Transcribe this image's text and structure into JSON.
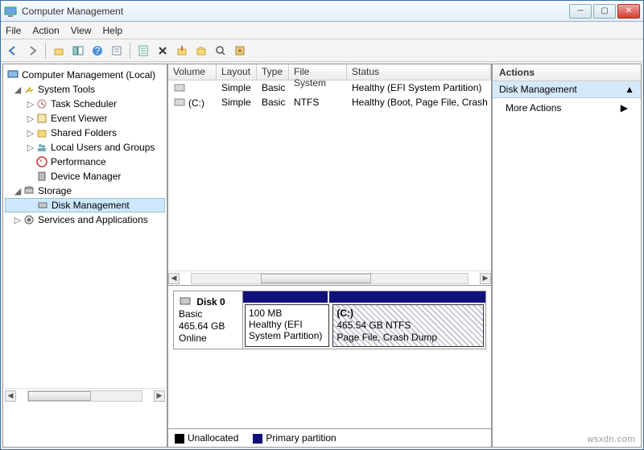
{
  "window": {
    "title": "Computer Management"
  },
  "menu": {
    "file": "File",
    "action": "Action",
    "view": "View",
    "help": "Help"
  },
  "toolbar_icons": [
    "back",
    "forward",
    "up",
    "show-hide",
    "help",
    "properties",
    "refresh",
    "delete",
    "export",
    "import",
    "find",
    "settings"
  ],
  "tree": {
    "root": "Computer Management (Local)",
    "system_tools": "System Tools",
    "task_scheduler": "Task Scheduler",
    "event_viewer": "Event Viewer",
    "shared_folders": "Shared Folders",
    "local_users": "Local Users and Groups",
    "performance": "Performance",
    "device_manager": "Device Manager",
    "storage": "Storage",
    "disk_management": "Disk Management",
    "services_apps": "Services and Applications"
  },
  "grid": {
    "headers": {
      "volume": "Volume",
      "layout": "Layout",
      "type": "Type",
      "fs": "File System",
      "status": "Status"
    },
    "rows": [
      {
        "volume": "",
        "layout": "Simple",
        "type": "Basic",
        "fs": "",
        "status": "Healthy (EFI System Partition)"
      },
      {
        "volume": "(C:)",
        "layout": "Simple",
        "type": "Basic",
        "fs": "NTFS",
        "status": "Healthy (Boot, Page File, Crash Dump"
      }
    ]
  },
  "disk": {
    "name": "Disk 0",
    "type": "Basic",
    "size": "465.64 GB",
    "state": "Online",
    "partitions": [
      {
        "label": "",
        "size": "100 MB",
        "status": "Healthy (EFI System Partition)"
      },
      {
        "label": "(C:)",
        "size": "465.54 GB NTFS",
        "status": "Page File, Crash Dump"
      }
    ]
  },
  "legend": {
    "unallocated": "Unallocated",
    "primary": "Primary partition"
  },
  "actions": {
    "title": "Actions",
    "section": "Disk Management",
    "more": "More Actions"
  },
  "watermark": "wsxdn.com"
}
